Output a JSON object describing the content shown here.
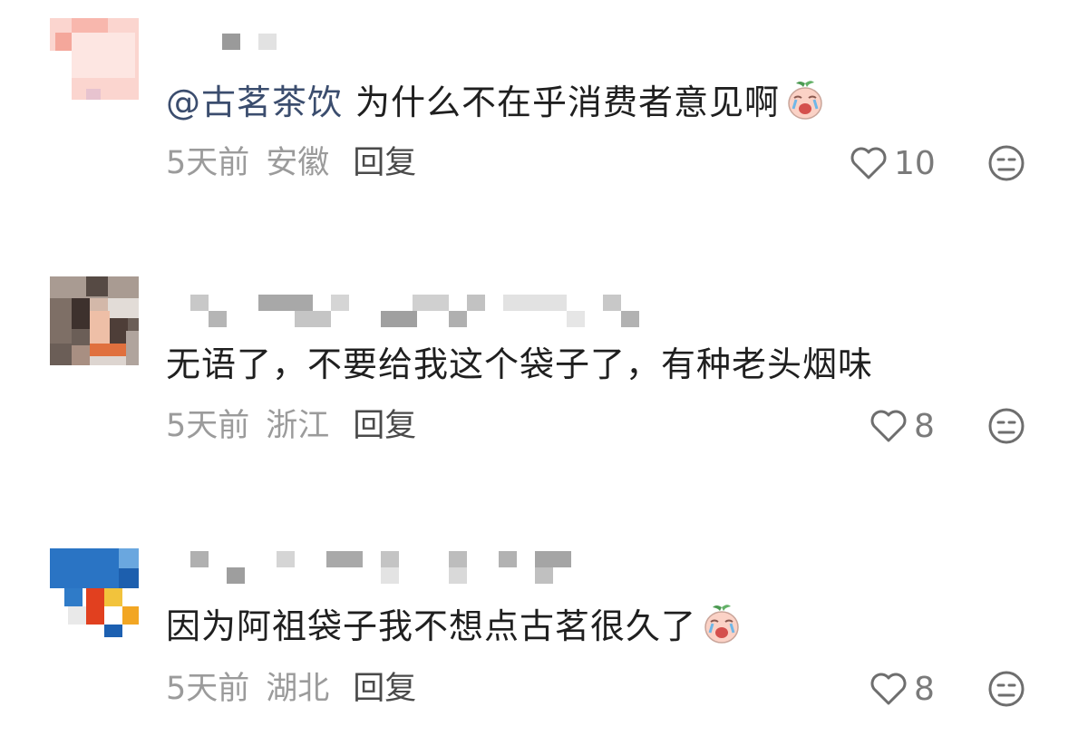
{
  "comments": [
    {
      "mention": "@古茗茶饮",
      "text": "为什么不在乎消费者意见啊",
      "emoji": "crying-radish-emoji",
      "time": "5天前",
      "location": "安徽",
      "reply_label": "回复",
      "likes": "10"
    },
    {
      "mention": "",
      "text": "无语了，不要给我这个袋子了，有种老头烟味",
      "emoji": "",
      "time": "5天前",
      "location": "浙江",
      "reply_label": "回复",
      "likes": "8"
    },
    {
      "mention": "",
      "text": "因为阿祖袋子我不想点古茗很久了",
      "emoji": "crying-radish-emoji",
      "time": "5天前",
      "location": "湖北",
      "reply_label": "回复",
      "likes": "8"
    }
  ],
  "icons": {
    "like": "heart-icon",
    "dislike": "dislike-face-icon"
  }
}
